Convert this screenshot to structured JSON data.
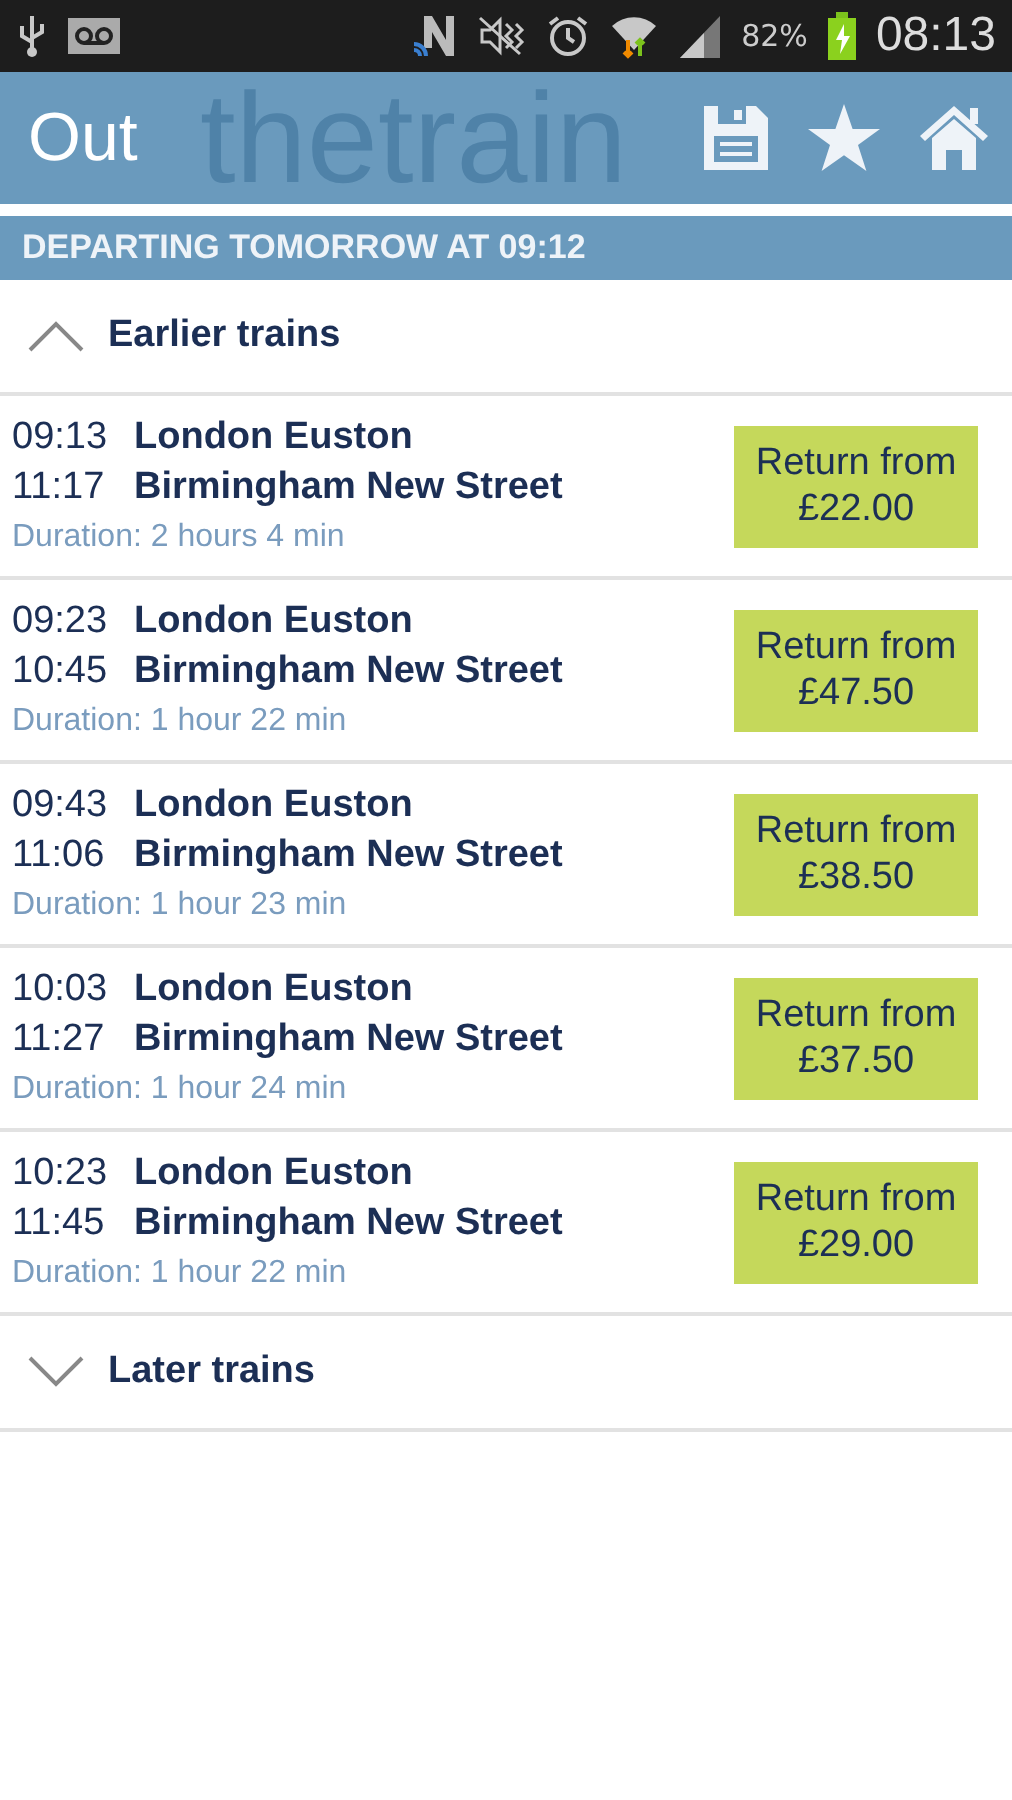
{
  "status_bar": {
    "battery": "82%",
    "time": "08:13"
  },
  "header": {
    "title": "Out",
    "background_logo": "thetrain"
  },
  "subheader": "DEPARTING TOMORROW AT 09:12",
  "earlier": {
    "label": "Earlier trains"
  },
  "trains": [
    {
      "depart": "09:13",
      "from": "London Euston",
      "arrive": "11:17",
      "to": "Birmingham New Street",
      "duration": "Duration: 2 hours 4 min",
      "price_label": "Return from",
      "price": "£22.00"
    },
    {
      "depart": "09:23",
      "from": "London Euston",
      "arrive": "10:45",
      "to": "Birmingham New Street",
      "duration": "Duration: 1 hour 22 min",
      "price_label": "Return from",
      "price": "£47.50"
    },
    {
      "depart": "09:43",
      "from": "London Euston",
      "arrive": "11:06",
      "to": "Birmingham New Street",
      "duration": "Duration: 1 hour 23 min",
      "price_label": "Return from",
      "price": "£38.50"
    },
    {
      "depart": "10:03",
      "from": "London Euston",
      "arrive": "11:27",
      "to": "Birmingham New Street",
      "duration": "Duration: 1 hour 24 min",
      "price_label": "Return from",
      "price": "£37.50"
    },
    {
      "depart": "10:23",
      "from": "London Euston",
      "arrive": "11:45",
      "to": "Birmingham New Street",
      "duration": "Duration: 1 hour 22 min",
      "price_label": "Return from",
      "price": "£29.00"
    }
  ],
  "later": {
    "label": "Later trains"
  }
}
